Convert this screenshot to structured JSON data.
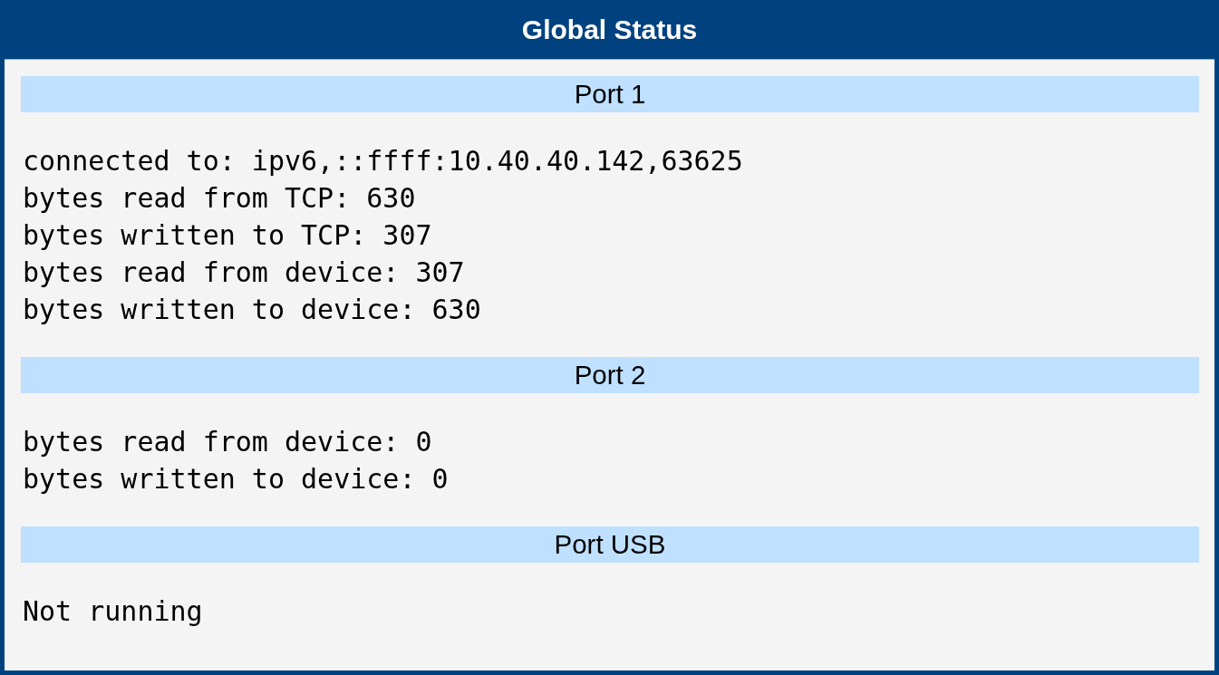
{
  "window": {
    "title": "Global Status"
  },
  "ports": [
    {
      "name": "Port 1",
      "lines": [
        "connected to: ipv6,::ffff:10.40.40.142,63625",
        "bytes read from TCP: 630",
        "bytes written to TCP: 307",
        "bytes read from device: 307",
        "bytes written to device: 630"
      ]
    },
    {
      "name": "Port 2",
      "lines": [
        "bytes read from device: 0",
        "bytes written to device: 0"
      ]
    },
    {
      "name": "Port USB",
      "lines": [
        "Not running"
      ]
    }
  ]
}
